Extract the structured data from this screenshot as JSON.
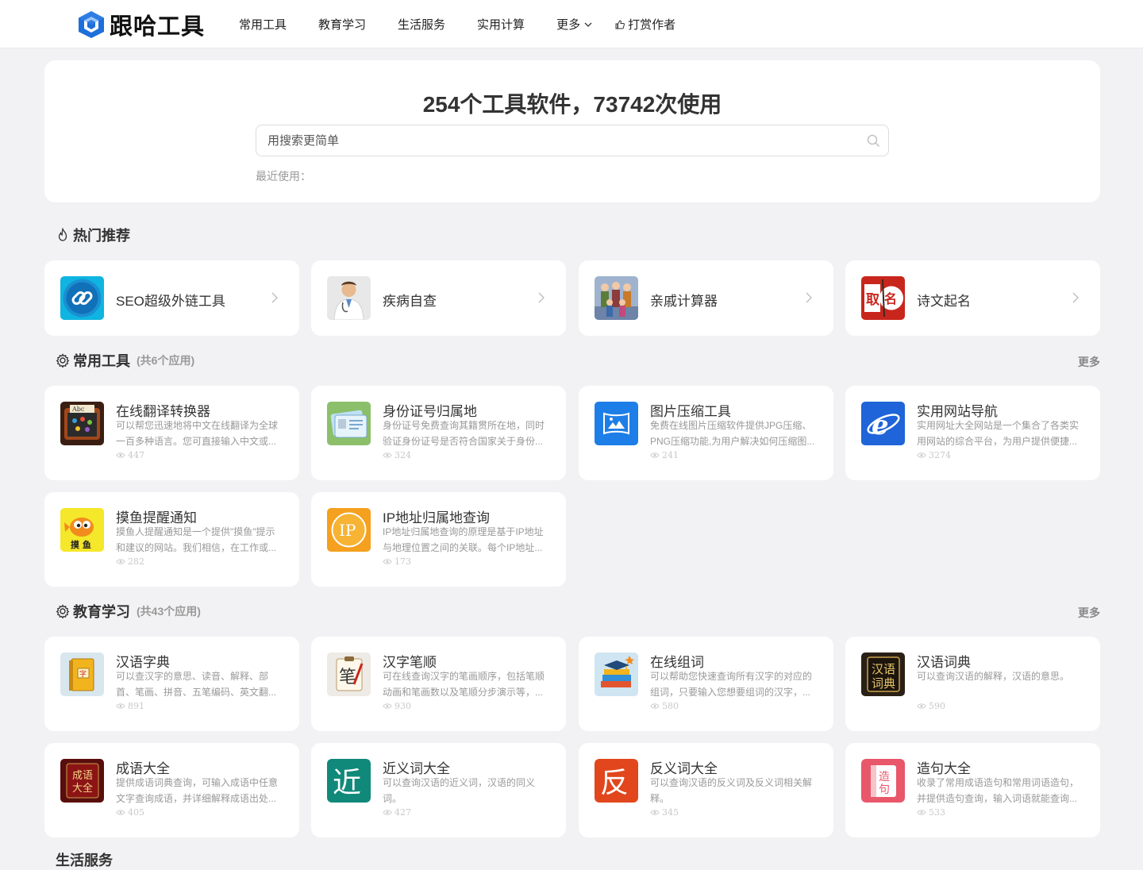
{
  "header": {
    "logo_text": "跟哈工具",
    "nav": [
      {
        "label": "常用工具"
      },
      {
        "label": "教育学习"
      },
      {
        "label": "生活服务"
      },
      {
        "label": "实用计算"
      },
      {
        "label": "更多"
      },
      {
        "label": "打赏作者"
      }
    ]
  },
  "hero": {
    "title": "254个工具软件，73742次使用",
    "search_placeholder": "用搜索更简单",
    "recent_label": "最近使用："
  },
  "hot": {
    "title": "热门推荐",
    "items": [
      {
        "name": "SEO超级外链工具",
        "icon": "link-icon"
      },
      {
        "name": "疾病自查",
        "icon": "doctor-icon"
      },
      {
        "name": "亲戚计算器",
        "icon": "family-icon"
      },
      {
        "name": "诗文起名",
        "icon": "naming-icon"
      }
    ]
  },
  "common": {
    "title": "常用工具",
    "count": "(共6个应用)",
    "more": "更多",
    "items": [
      {
        "name": "在线翻译转换器",
        "desc": "可以帮您迅速地将中文在线翻译为全球一百多种语言。您可直接输入中文或...",
        "views": "447",
        "icon": "translate-icon"
      },
      {
        "name": "身份证号归属地",
        "desc": "身份证号免费查询其籍贯所在地，同时验证身份证号是否符合国家关于身份...",
        "views": "324",
        "icon": "id-card-icon"
      },
      {
        "name": "图片压缩工具",
        "desc": "免费在线图片压缩软件提供JPG压缩、PNG压缩功能,为用户解决如何压缩图...",
        "views": "241",
        "icon": "image-compress-icon"
      },
      {
        "name": "实用网站导航",
        "desc": "实用网址大全网站是一个集合了各类实用网站的综合平台，为用户提供便捷...",
        "views": "3274",
        "icon": "browser-icon"
      },
      {
        "name": "摸鱼提醒通知",
        "desc": "摸鱼人提醒通知是一个提供\"摸鱼\"提示和建议的网站。我们相信，在工作或...",
        "views": "282",
        "icon": "fish-icon"
      },
      {
        "name": "IP地址归属地查询",
        "desc": "IP地址归属地查询的原理是基于IP地址与地理位置之间的关联。每个IP地址...",
        "views": "173",
        "icon": "ip-icon"
      }
    ]
  },
  "education": {
    "title": "教育学习",
    "count": "(共43个应用)",
    "more": "更多",
    "items": [
      {
        "name": "汉语字典",
        "desc": "可以查汉字的意思、读音、解释、部首、笔画、拼音、五笔编码、英文翻...",
        "views": "891",
        "icon": "dictionary-icon"
      },
      {
        "name": "汉字笔顺",
        "desc": "可在线查询汉字的笔画顺序，包括笔顺动画和笔画数以及笔顺分步演示等，...",
        "views": "930",
        "icon": "stroke-icon"
      },
      {
        "name": "在线组词",
        "desc": "可以帮助您快速查询所有汉字的对应的组词，只要输入您想要组词的汉字，...",
        "views": "580",
        "icon": "books-icon"
      },
      {
        "name": "汉语词典",
        "desc": "可以查询汉语的解释，汉语的意思。",
        "views": "590",
        "icon": "word-dict-icon"
      },
      {
        "name": "成语大全",
        "desc": "提供成语词典查询，可输入成语中任意文字查询成语，并详细解释成语出处...",
        "views": "405",
        "icon": "idiom-icon"
      },
      {
        "name": "近义词大全",
        "desc": "可以查询汉语的近义词，汉语的同义词。",
        "views": "427",
        "icon": "synonym-icon"
      },
      {
        "name": "反义词大全",
        "desc": "可以查询汉语的反义词及反义词相关解释。",
        "views": "345",
        "icon": "antonym-icon"
      },
      {
        "name": "造句大全",
        "desc": "收录了常用成语造句和常用词语造句，并提供造句查询，输入词语就能查询...",
        "views": "533",
        "icon": "sentence-icon"
      }
    ]
  },
  "next_section": {
    "title": "生活服务"
  }
}
